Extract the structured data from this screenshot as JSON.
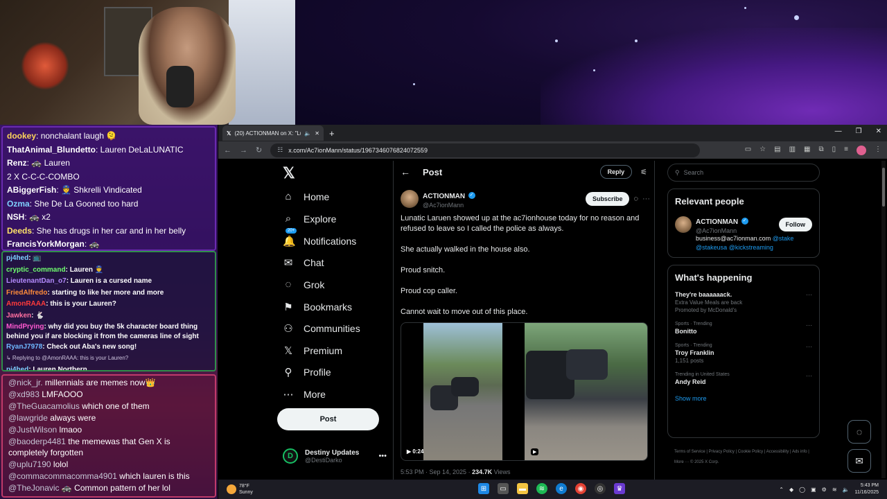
{
  "chat": {
    "section1": [
      {
        "user": "dookey",
        "msg": "nonchalant laugh 🫠"
      },
      {
        "user": "ThatAnimal_Blundetto",
        "msg": "Lauren DeLaLUNATIC"
      },
      {
        "user": "Renz",
        "msg": "🚓 Lauren"
      },
      {
        "user": "",
        "msg": "2 X C-C-C-COMBO"
      },
      {
        "user": "ABiggerFish",
        "msg": "👮 Shkrelli Vindicated"
      },
      {
        "user": "Ozma",
        "msg": "She De La Gooned too hard"
      },
      {
        "user": "NSH",
        "msg": "🚓 x2"
      },
      {
        "user": "Deeds",
        "msg": "She has drugs in her car and in her belly"
      },
      {
        "user": "FrancisYorkMorgan",
        "msg": "🚓"
      }
    ],
    "section2": [
      {
        "user": "pj4hed",
        "msg": "📺",
        "color": "#7fd0ff"
      },
      {
        "user": "cryptic_command",
        "msg": "Lauren 👮",
        "color": "#6fff6f"
      },
      {
        "user": "LieutenantDan_o7",
        "msg": "Lauren is a cursed name",
        "color": "#b58cff"
      },
      {
        "user": "FriedAlfredo",
        "msg": "starting to like her more and more",
        "color": "#ff8c3a"
      },
      {
        "user": "AmonRAAA",
        "msg": "this is your Lauren?",
        "color": "#ff3a3a"
      },
      {
        "user": "Jawken",
        "msg": "🐇",
        "color": "#ff6fa0"
      },
      {
        "user": "MindPrying",
        "msg": "why did you buy the 5k character board thing behind you if are blocking it from the cameras line of sight",
        "color": "#ff5ad0"
      },
      {
        "user": "RyanJ7978",
        "msg": "Check out Aba's new song!",
        "color": "#6fb8ff"
      },
      {
        "reply": "↳ Replying to @AmonRAAA: this is your Lauren?"
      },
      {
        "user": "pj4hed",
        "msg": "Lauren Northern",
        "color": "#7fd0ff"
      }
    ],
    "section3": [
      {
        "user": "@nick_jr.",
        "msg": "millennials are memes now👑"
      },
      {
        "user": "@xd983",
        "msg": "LMFAOOO"
      },
      {
        "user": "@TheGuacamolius",
        "msg": "which one of them"
      },
      {
        "user": "@lawgride",
        "msg": "always were"
      },
      {
        "user": "@JustWilson",
        "msg": "lmaoo"
      },
      {
        "user": "@baoderp4481",
        "msg": "the memewas that Gen X is completely forgotten"
      },
      {
        "user": "@uplu7190",
        "msg": "lolol"
      },
      {
        "user": "@commacommacomma4901",
        "msg": "which lauren is this"
      },
      {
        "user": "@TheJonavic",
        "msg": "🚓 Common pattern of her lol"
      }
    ]
  },
  "browser": {
    "tab_title": "(20) ACTIONMAN on X: \"Lu",
    "new_tab": "+",
    "url": "x.com/Ac7ionMann/status/1967346076824072559"
  },
  "x": {
    "logo": "𝕏",
    "nav": [
      {
        "label": "Home",
        "icon": "⌂",
        "name": "home"
      },
      {
        "label": "Explore",
        "icon": "⌕",
        "name": "explore"
      },
      {
        "label": "Notifications",
        "icon": "🔔",
        "name": "notifications"
      },
      {
        "label": "Chat",
        "icon": "✉",
        "name": "chat"
      },
      {
        "label": "Grok",
        "icon": "◌",
        "name": "grok"
      },
      {
        "label": "Bookmarks",
        "icon": "⚑",
        "name": "bookmarks"
      },
      {
        "label": "Communities",
        "icon": "⚇",
        "name": "communities"
      },
      {
        "label": "Premium",
        "icon": "𝕏",
        "name": "premium"
      },
      {
        "label": "Profile",
        "icon": "⚲",
        "name": "profile"
      },
      {
        "label": "More",
        "icon": "⋯",
        "name": "more"
      }
    ],
    "notif_badge": "20+",
    "post_button": "Post",
    "account": {
      "name": "Destiny Updates",
      "handle": "@DestiDarko",
      "avatar": "D"
    },
    "header": {
      "title": "Post",
      "reply": "Reply"
    },
    "post": {
      "author": "ACTIONMAN",
      "handle": "@Ac7ionMann",
      "subscribe": "Subscribe",
      "paragraphs": [
        "Lunatic Laruen showed up at the ac7ionhouse today for no reason and refused to leave so I called the police as always.",
        "She actually walked in the house also.",
        "Proud snitch.",
        "Proud cop caller.",
        "Cannot wait to move out of this place."
      ],
      "video_duration": "0:24",
      "timestamp": "5:53 PM · Sep 14, 2025 · ",
      "views": "234.7K",
      "views_label": " Views"
    },
    "search_placeholder": "Search",
    "relevant": {
      "title": "Relevant people",
      "name": "ACTIONMAN",
      "handle": "@Ac7ionMann",
      "follow": "Follow",
      "bio_text": "business@ac7ionman.com ",
      "bio_link1": "@stake",
      "bio_link2": "@stakeusa",
      "bio_link3": "@kickstreaming"
    },
    "happening": {
      "title": "What's happening",
      "trends": [
        {
          "cat": "",
          "name": "They're baaaaaack.",
          "sub": "Extra Value Meals are back",
          "sub2": "Promoted by McDonald's"
        },
        {
          "cat": "Sports · Trending",
          "name": "Bonitto",
          "sub": "",
          "sub2": ""
        },
        {
          "cat": "Sports · Trending",
          "name": "Troy Franklin",
          "sub": "1,151 posts",
          "sub2": ""
        },
        {
          "cat": "Trending in United States",
          "name": "Andy Reid",
          "sub": "",
          "sub2": ""
        }
      ],
      "show_more": "Show more"
    },
    "footer": "Terms of Service  |  Privacy Policy  |  Cookie Policy  |  Accessibility  |  Ads info  |  More ···  © 2025 X Corp."
  },
  "taskbar": {
    "temp": "78°F",
    "condition": "Sunny",
    "time": "5:43 PM",
    "date": "11/16/2025"
  }
}
